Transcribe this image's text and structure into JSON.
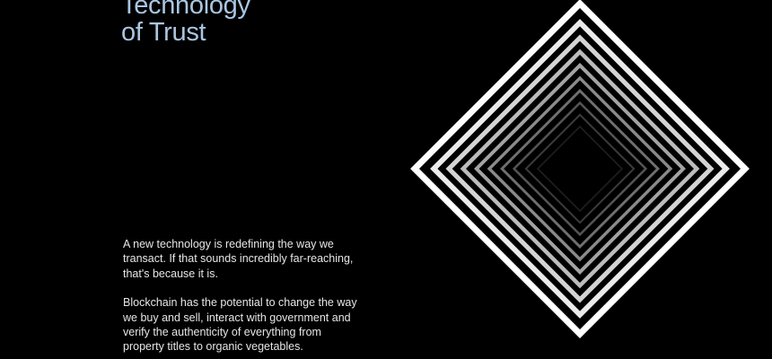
{
  "headline": {
    "line1": "Technology",
    "line2": "of Trust"
  },
  "body": {
    "paragraph1": "A new technology is redefining the way we transact. If that sounds incredibly far-reaching, that's because it is.",
    "paragraph2": "Blockchain has the potential to change the way we buy and sell, interact with government and verify the authenticity of everything from property titles to organic vegetables."
  },
  "colors": {
    "background": "#000000",
    "headline": "#a9c6e2",
    "body_text": "#e6e6e6",
    "frame_outer": "#ffffff",
    "frame_inner": "#1f1f1f"
  },
  "illustration": {
    "icon": "nested-diamonds-icon",
    "frame_count": 10
  }
}
